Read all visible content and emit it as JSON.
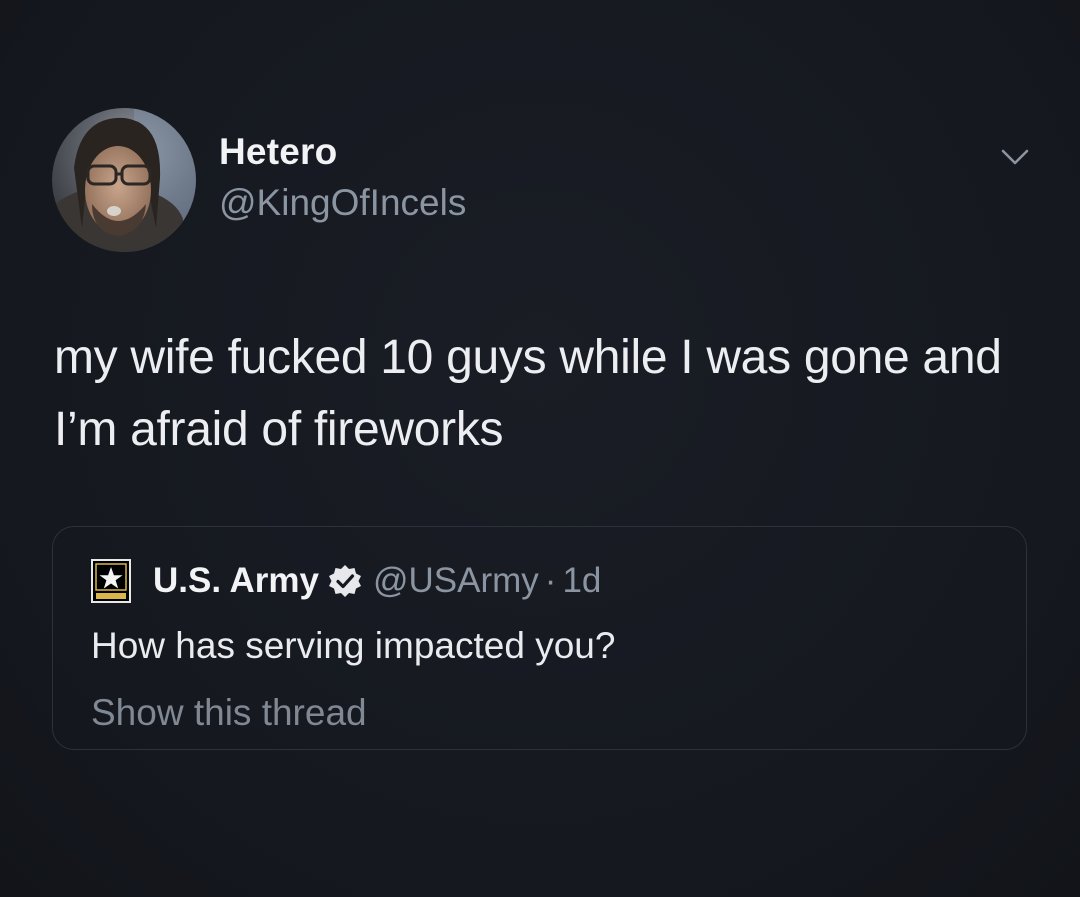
{
  "author": {
    "display_name": "Hetero",
    "handle": "@KingOfIncels",
    "avatar_icon": "user-photo-avatar"
  },
  "menu_icon": "chevron-down-icon",
  "tweet_text": "my wife fucked 10 guys while I was gone and I’m afraid of fireworks",
  "quoted_tweet": {
    "display_name": "U.S. Army",
    "handle": "@USArmy",
    "separator": "·",
    "time": "1d",
    "logo_icon": "us-army-star-logo",
    "verified_icon": "verified-badge-icon",
    "text": "How has serving impacted you?",
    "show_thread_label": "Show this thread"
  },
  "colors": {
    "background": "#15181f",
    "primary_text": "#eceef1",
    "secondary_text": "#8b95a1",
    "card_border": "#2c313b"
  }
}
